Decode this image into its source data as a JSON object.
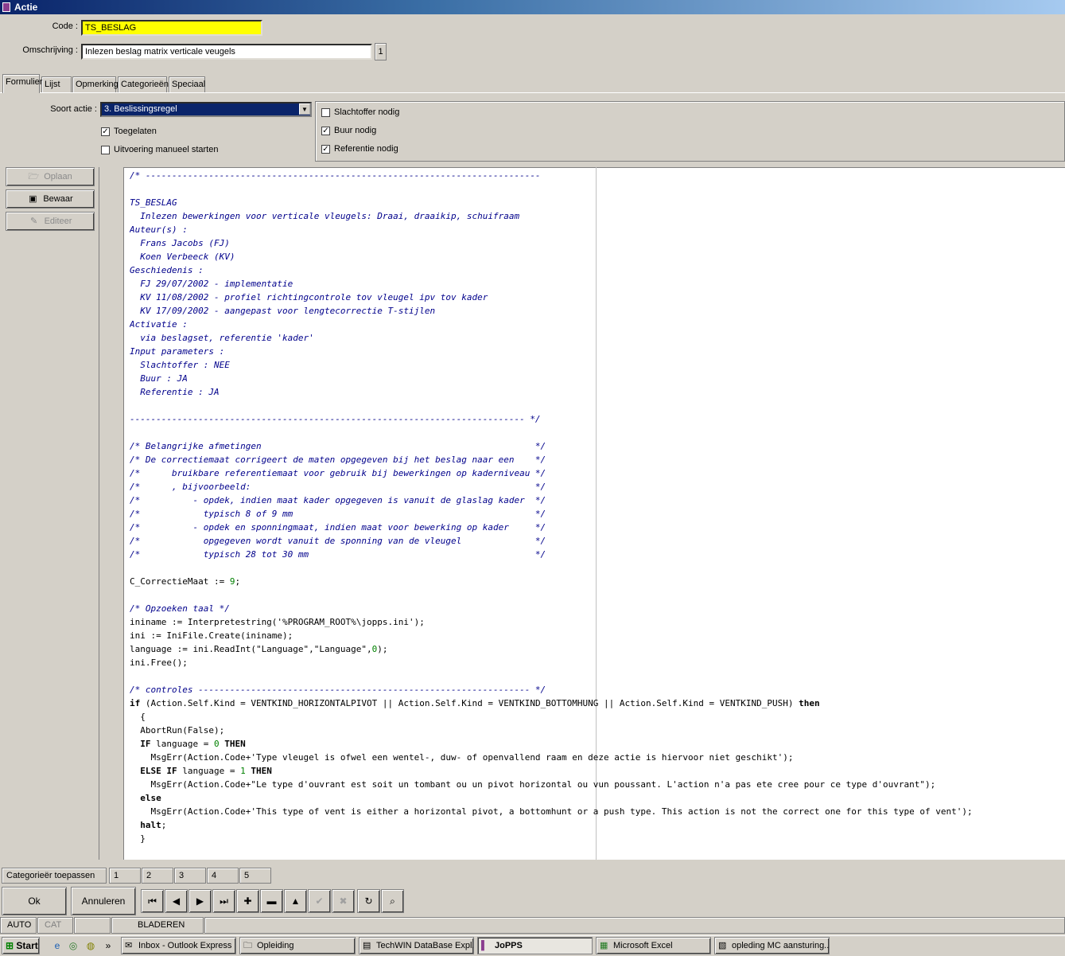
{
  "window": {
    "title": "Actie"
  },
  "form": {
    "code_label": "Code :",
    "code_value": "TS_BESLAG",
    "desc_label": "Omschrijving :",
    "desc_value": "Inlezen beslag matrix verticale veugels",
    "desc_button": "1"
  },
  "tabs": [
    {
      "label": "Formulier",
      "active": true
    },
    {
      "label": "Lijst"
    },
    {
      "label": "Opmerking"
    },
    {
      "label": "Categorieën"
    },
    {
      "label": "Speciaal"
    }
  ],
  "soort": {
    "label": "Soort actie :",
    "selected": "3. Beslissingsregel",
    "toegelaten_label": "Toegelaten",
    "toegelaten_checked": true,
    "manueel_label": "Uitvoering manueel starten",
    "manueel_checked": false
  },
  "flags": [
    {
      "label": "Slachtoffer nodig",
      "checked": false
    },
    {
      "label": "Buur nodig",
      "checked": true
    },
    {
      "label": "Referentie nodig",
      "checked": true
    }
  ],
  "side_buttons": {
    "open": "Oplaan",
    "save": "Bewaar",
    "edit": "Editeer"
  },
  "code_lines": [
    "/* ---------------------------------------------------------------------------",
    "",
    "TS_BESLAG",
    "  Inlezen bewerkingen voor verticale vleugels: Draai, draaikip, schuifraam",
    "Auteur(s) :",
    "  Frans Jacobs (FJ)",
    "  Koen Verbeeck (KV)",
    "Geschiedenis :",
    "  FJ 29/07/2002 - implementatie",
    "  KV 11/08/2002 - profiel richtingcontrole tov vleugel ipv tov kader",
    "  KV 17/09/2002 - aangepast voor lengtecorrectie T-stijlen",
    "Activatie :",
    "  via beslagset, referentie 'kader'",
    "Input parameters :",
    "  Slachtoffer : NEE",
    "  Buur : JA",
    "  Referentie : JA",
    "",
    "--------------------------------------------------------------------------- */",
    "",
    "/* Belangrijke afmetingen                                                    */",
    "/* De correctiemaat corrigeert de maten opgegeven bij het beslag naar een    */",
    "/*      bruikbare referentiemaat voor gebruik bij bewerkingen op kaderniveau */",
    "/*      , bijvoorbeeld:                                                      */",
    "/*          - opdek, indien maat kader opgegeven is vanuit de glaslag kader  */",
    "/*            typisch 8 of 9 mm                                              */",
    "/*          - opdek en sponningmaat, indien maat voor bewerking op kader     */",
    "/*            opgegeven wordt vanuit de sponning van de vleugel              */",
    "/*            typisch 28 tot 30 mm                                           */",
    "",
    "C_CorrectieMaat := 9;",
    "",
    "/* Opzoeken taal */",
    "ininame := Interpretestring('%PROGRAM_ROOT%\\jopps.ini');",
    "ini := IniFile.Create(ininame);",
    "language := ini.ReadInt(\"Language\",\"Language\",0);",
    "ini.Free();",
    "",
    "/* controles --------------------------------------------------------------- */",
    "if (Action.Self.Kind = VENTKIND_HORIZONTALPIVOT || Action.Self.Kind = VENTKIND_BOTTOMHUNG || Action.Self.Kind = VENTKIND_PUSH) then",
    "  {",
    "  AbortRun(False);",
    "  IF language = 0 THEN",
    "    MsgErr(Action.Code+'Type vleugel is ofwel een wentel-, duw- of openvallend raam en deze actie is hiervoor niet geschikt');",
    "  ELSE IF language = 1 THEN",
    "    MsgErr(Action.Code+\"Le type d'ouvrant est soit un tombant ou un pivot horizontal ou vun poussant. L'action n'a pas ete cree pour ce type d'ouvrant\");",
    "  else",
    "    MsgErr(Action.Code+'This type of vent is either a horizontal pivot, a bottomhunt or a push type. This action is not the correct one for this type of vent');",
    "  halt;",
    "  }"
  ],
  "categories": {
    "apply_label": "Categorieër toepassen",
    "slots": [
      "1",
      "2",
      "3",
      "4",
      "5"
    ]
  },
  "bottom_buttons": {
    "ok": "Ok",
    "cancel": "Annuleren"
  },
  "nav_icons": [
    "first-icon",
    "prev-icon",
    "next-icon",
    "last-icon",
    "add-icon",
    "delete-icon",
    "up-icon",
    "confirm-icon",
    "cancel-edit-icon",
    "refresh-icon",
    "find-icon"
  ],
  "status": {
    "auto": "AUTO",
    "cat": "CAT",
    "empty": "",
    "mode": "BLADEREN"
  },
  "taskbar": {
    "start": "Start",
    "overflow": "»",
    "tasks": [
      {
        "label": "Inbox - Outlook Express",
        "icon": "outlook-icon"
      },
      {
        "label": "Opleiding",
        "icon": "folder-icon"
      },
      {
        "label": "TechWIN DataBase Expl...",
        "icon": "database-icon"
      },
      {
        "label": "JoPPS",
        "icon": "jopps-icon",
        "active": true
      },
      {
        "label": "Microsoft Excel",
        "icon": "excel-icon"
      },
      {
        "label": "opleding MC aansturing....",
        "icon": "document-icon"
      }
    ]
  }
}
